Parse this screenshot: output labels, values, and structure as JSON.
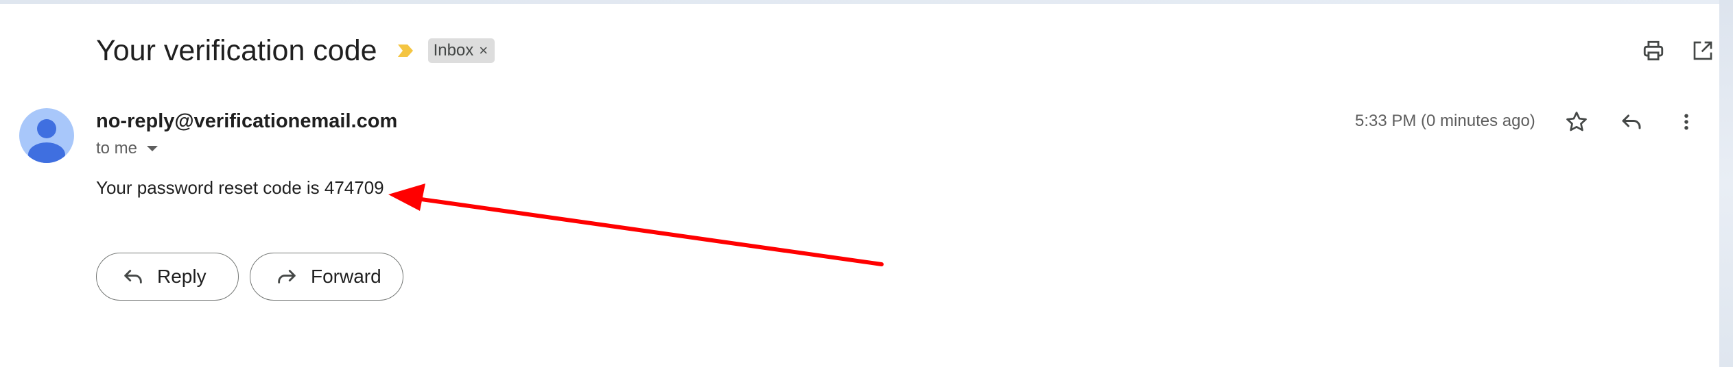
{
  "header": {
    "subject": "Your verification code",
    "label_chip": "Inbox",
    "label_remove": "×",
    "importance_color": "#f4c542"
  },
  "message": {
    "sender": "no-reply@verificationemail.com",
    "recipient": "to me",
    "timestamp": "5:33 PM (0 minutes ago)",
    "body": "Your password reset code is 474709"
  },
  "actions": {
    "reply_label": "Reply",
    "forward_label": "Forward"
  },
  "icons": [
    "print-icon",
    "open-in-new-window-icon",
    "star-icon",
    "reply-icon",
    "more-vert-icon",
    "person-icon",
    "chevron-down-icon"
  ],
  "colors": {
    "annotation_arrow": "#ff0000",
    "avatar_bg": "#a8c7fa",
    "avatar_fg": "#3f6fe0"
  }
}
